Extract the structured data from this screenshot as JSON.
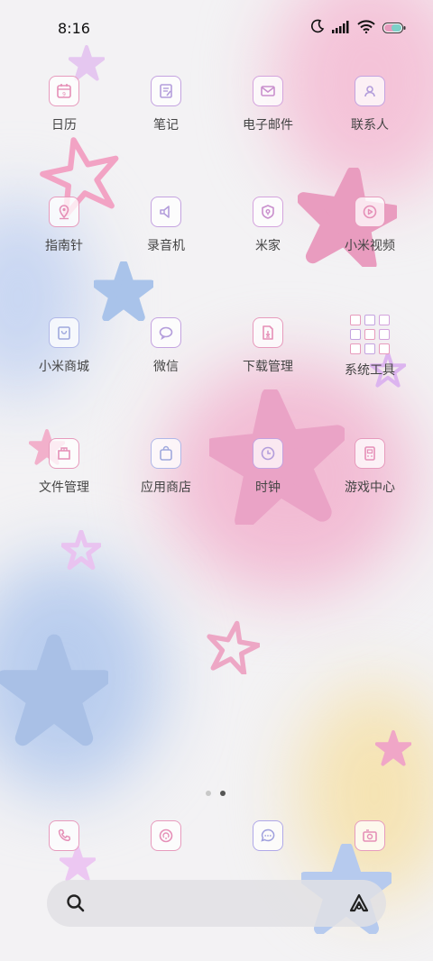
{
  "status_bar": {
    "time": "8:16",
    "icons": [
      "moon-icon",
      "signal-icon",
      "wifi-icon",
      "battery-icon"
    ]
  },
  "apps": [
    {
      "label": "日历",
      "icon": "calendar-icon"
    },
    {
      "label": "笔记",
      "icon": "notes-icon"
    },
    {
      "label": "电子邮件",
      "icon": "mail-icon"
    },
    {
      "label": "联系人",
      "icon": "contacts-icon"
    },
    {
      "label": "指南针",
      "icon": "compass-icon"
    },
    {
      "label": "录音机",
      "icon": "recorder-icon"
    },
    {
      "label": "米家",
      "icon": "home-icon"
    },
    {
      "label": "小米视频",
      "icon": "video-icon"
    },
    {
      "label": "小米商城",
      "icon": "store-icon"
    },
    {
      "label": "微信",
      "icon": "wechat-icon"
    },
    {
      "label": "下载管理",
      "icon": "download-icon"
    },
    {
      "label": "系统工具",
      "icon": "folder-icon"
    },
    {
      "label": "文件管理",
      "icon": "files-icon"
    },
    {
      "label": "应用商店",
      "icon": "appstore-icon"
    },
    {
      "label": "时钟",
      "icon": "clock-icon"
    },
    {
      "label": "游戏中心",
      "icon": "game-icon"
    }
  ],
  "page_indicator": {
    "count": 2,
    "active_index": 1
  },
  "dock": [
    {
      "icon": "phone-icon"
    },
    {
      "icon": "browser-icon"
    },
    {
      "icon": "messages-icon"
    },
    {
      "icon": "camera-icon"
    }
  ],
  "search_bar": {
    "left_icon": "search-icon",
    "right_icon": "assistant-icon"
  },
  "colors": {
    "pink": "#e58fb7",
    "lavender": "#b39ddb",
    "blue": "#9fb7e2",
    "yellow": "#f3e1a8"
  }
}
